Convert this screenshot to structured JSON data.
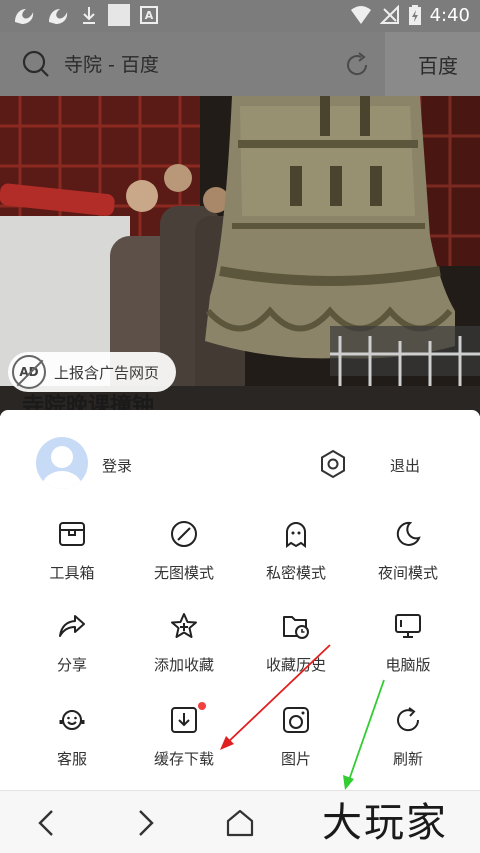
{
  "status_bar": {
    "time": "4:40",
    "icons": [
      "uc-browser-icon",
      "uc-browser-icon",
      "download-icon",
      "app-square-icon",
      "a-box-icon",
      "wifi-icon",
      "no-signal-icon",
      "battery-icon"
    ]
  },
  "address_bar": {
    "query": "寺院 - 百度",
    "action": "百度",
    "icons": [
      "search-icon",
      "refresh-icon"
    ]
  },
  "content": {
    "ad_report": "上报含广告网页",
    "ad_badge": "AD",
    "article_title": "寺院晚课撞钟"
  },
  "menu": {
    "login": "登录",
    "logout": "退出",
    "items": [
      {
        "label": "工具箱",
        "icon": "toolbox-icon"
      },
      {
        "label": "无图模式",
        "icon": "no-image-icon"
      },
      {
        "label": "私密模式",
        "icon": "ghost-icon"
      },
      {
        "label": "夜间模式",
        "icon": "moon-icon"
      },
      {
        "label": "分享",
        "icon": "share-icon"
      },
      {
        "label": "添加收藏",
        "icon": "star-plus-icon"
      },
      {
        "label": "收藏历史",
        "icon": "folder-clock-icon"
      },
      {
        "label": "电脑版",
        "icon": "monitor-icon"
      },
      {
        "label": "客服",
        "icon": "headset-icon"
      },
      {
        "label": "缓存下载",
        "icon": "download-box-icon"
      },
      {
        "label": "图片",
        "icon": "camera-icon"
      },
      {
        "label": "刷新",
        "icon": "refresh-icon"
      }
    ]
  },
  "nav": {
    "icons": [
      "back-icon",
      "forward-icon",
      "home-icon"
    ]
  },
  "watermark": "大玩家",
  "colors": {
    "status_bar": "#7c7c7c",
    "address_bar": "#8a8a8a",
    "avatar_bg": "#c7dbf7",
    "red_dot": "#f04040",
    "arrow_red": "#e02020",
    "arrow_green": "#33cc33"
  }
}
